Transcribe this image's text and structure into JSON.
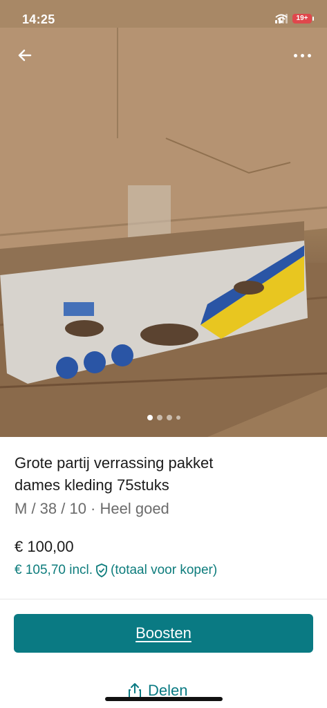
{
  "status_bar": {
    "time": "14:25",
    "battery": "19+"
  },
  "nav": {
    "back_icon": "arrow-left-icon",
    "more_icon": "more-horizontal-icon"
  },
  "carousel": {
    "total": 4,
    "active": 1
  },
  "listing": {
    "title_line1": "Grote partij verrassing pakket",
    "title_line2": "dames kleding 75stuks",
    "meta": "M / 38 / 10 · Heel goed",
    "price": "€ 100,00",
    "price_incl": "€ 105,70 incl.",
    "price_incl_note": "(totaal voor koper)",
    "shield_icon": "shield-check-icon"
  },
  "actions": {
    "boost_label": "Boosten",
    "share_label": "Delen",
    "share_icon": "share-icon"
  },
  "colors": {
    "accent": "#0a7a83",
    "link": "#0d7c7c",
    "battery_low": "#e0474c"
  }
}
